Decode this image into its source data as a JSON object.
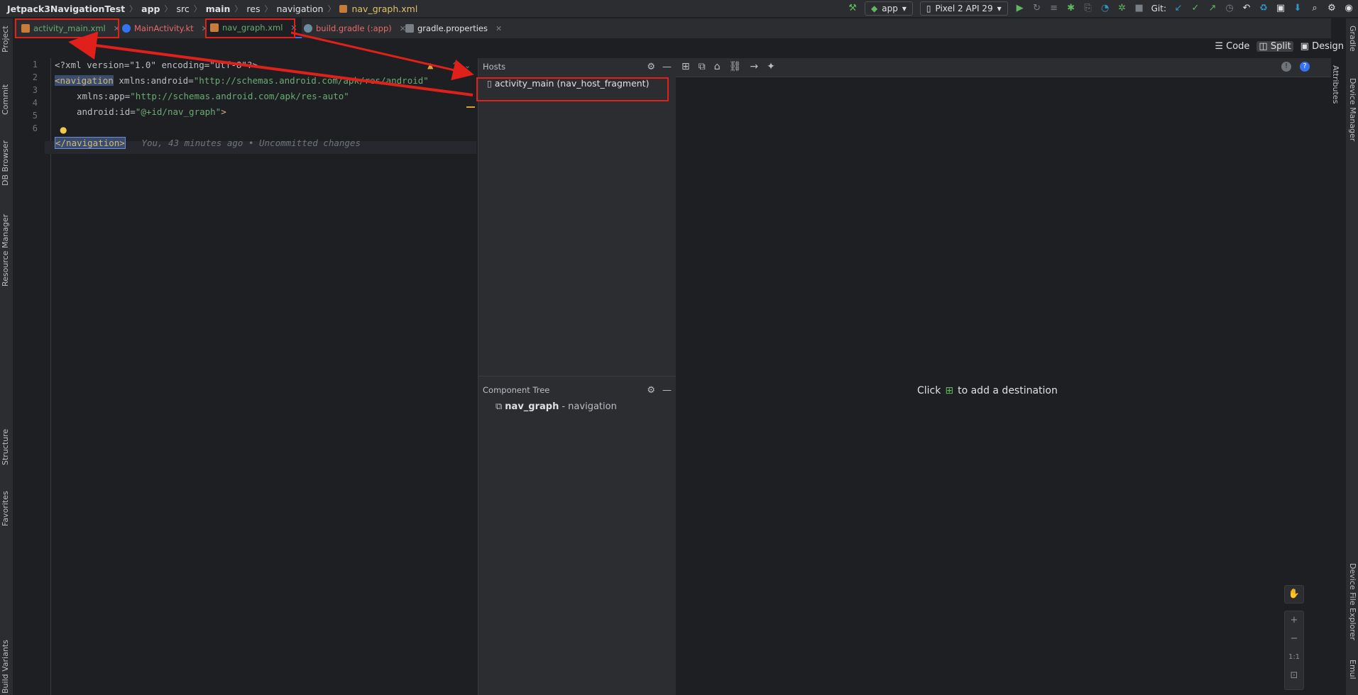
{
  "navbar": {
    "breadcrumb": [
      "Jetpack3NavigationTest",
      "app",
      "src",
      "main",
      "res",
      "navigation",
      "nav_graph.xml"
    ],
    "run_config": "app",
    "device": "Pixel 2 API 29",
    "git_label": "Git:"
  },
  "tabs": [
    {
      "label": "activity_main.xml",
      "color": "#6aab73",
      "icon": "xml-layout-icon"
    },
    {
      "label": "MainActivity.kt",
      "color": "#e86a6a",
      "icon": "kotlin-file-icon"
    },
    {
      "label": "nav_graph.xml",
      "color": "#6aab73",
      "icon": "xml-navigation-icon"
    },
    {
      "label": "build.gradle (:app)",
      "color": "#e86a6a",
      "icon": "gradle-icon"
    },
    {
      "label": "gradle.properties",
      "color": "#dfe1e5",
      "icon": "properties-icon"
    }
  ],
  "left_tools": [
    "Project",
    "Commit",
    "DB Browser",
    "Resource Manager",
    "Structure",
    "Favorites",
    "Build Variants"
  ],
  "right_tools": [
    "Gradle",
    "Device Manager",
    "Attributes",
    "Device File Explorer",
    "Emul"
  ],
  "view_modes": {
    "code": "Code",
    "split": "Split",
    "design": "Design"
  },
  "editor": {
    "line_numbers": [
      "1",
      "2",
      "3",
      "4",
      "5",
      "6"
    ],
    "line1": "<?xml version=\"1.0\" encoding=\"utf-8\"?>",
    "line2_tag": "<navigation",
    "line2_attr": " xmlns:android=",
    "line2_val": "\"http://schemas.android.com/apk/res/android\"",
    "line3_attr": "xmlns:app=",
    "line3_val": "\"http://schemas.android.com/apk/res-auto\"",
    "line4_attr": "android:id=",
    "line4_val": "\"@+id/nav_graph\"",
    "line4_end": ">",
    "line6_tag": "</navigation>",
    "line6_blame": "You, 43 minutes ago • Uncommitted changes"
  },
  "hosts": {
    "title": "Hosts",
    "item": "activity_main (nav_host_fragment)"
  },
  "component_tree": {
    "title": "Component Tree",
    "root_name": "nav_graph",
    "root_type": " - navigation"
  },
  "canvas": {
    "hint_before": "Click",
    "hint_after": "to add a destination",
    "zoom_reset": "1:1"
  },
  "colors": {
    "annotation": "#e0201b",
    "accent": "#3574f0"
  }
}
